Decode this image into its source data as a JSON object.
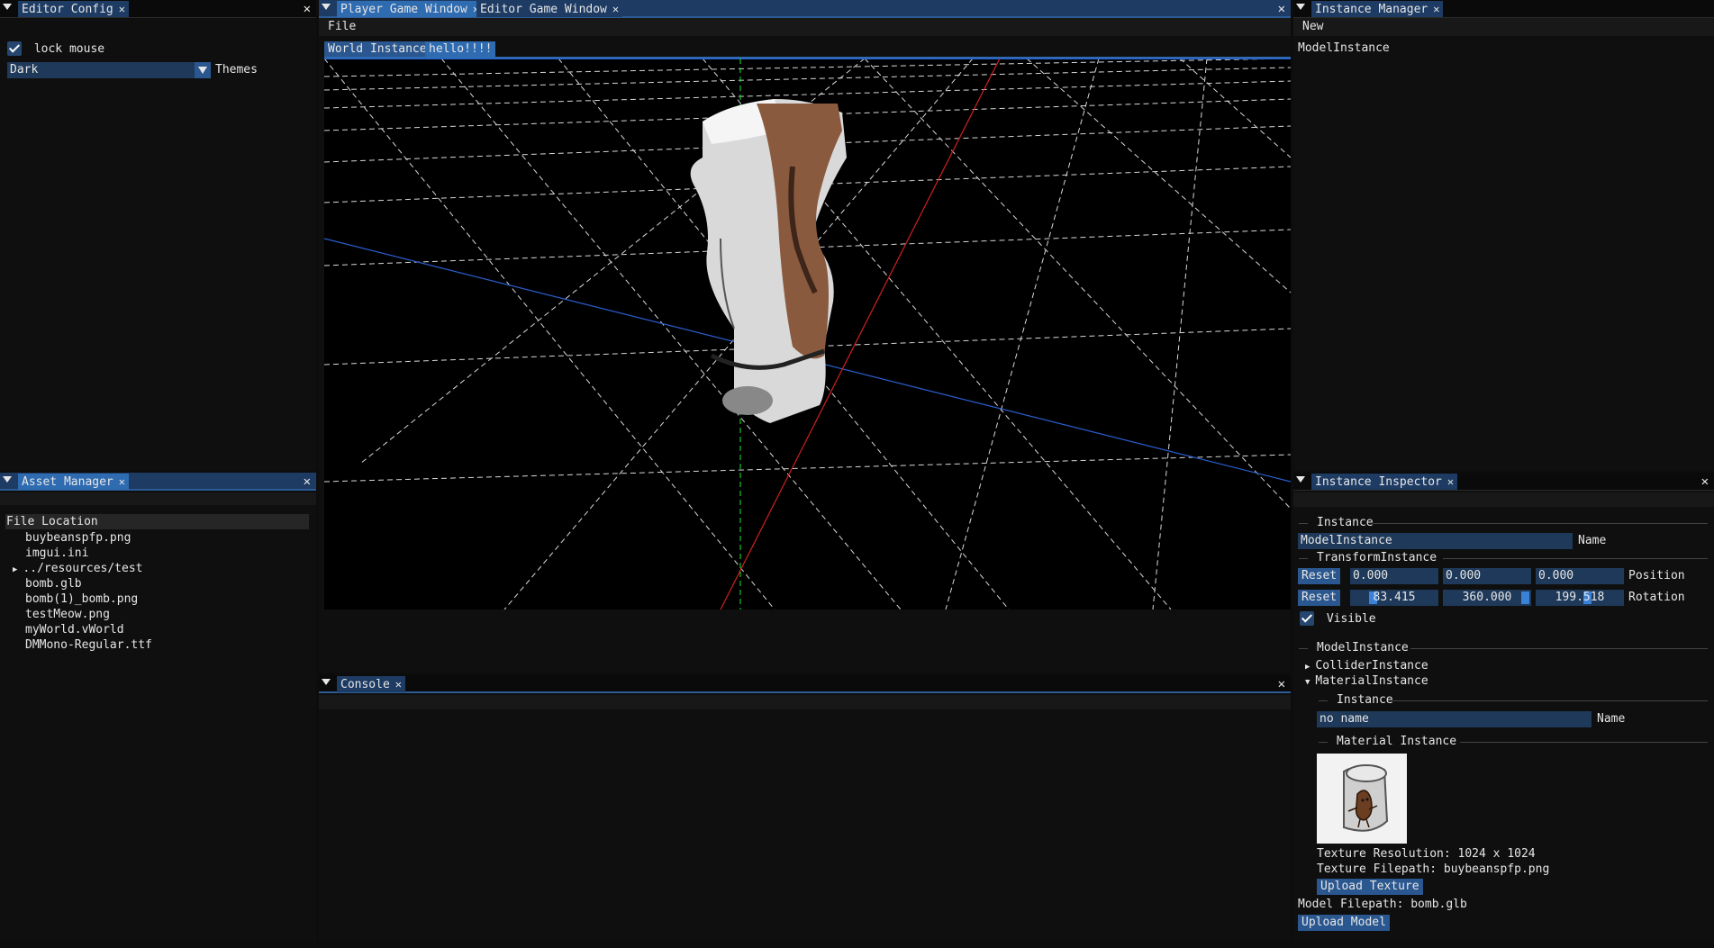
{
  "editor_config": {
    "tab": "Editor Config",
    "lock_mouse_label": "lock mouse",
    "theme_value": "Dark",
    "themes_label": "Themes"
  },
  "asset_manager": {
    "tab": "Asset Manager",
    "header": "File Location",
    "files": [
      "buybeanspfp.png",
      "imgui.ini",
      "../resources/test",
      "bomb.glb",
      "bomb(1)_bomb.png",
      "testMeow.png",
      "myWorld.vWorld",
      "DMMono-Regular.ttf"
    ]
  },
  "game_window": {
    "tab_player": "Player Game Window",
    "tab_editor": "Editor Game Window",
    "menu_file": "File",
    "inner_tab_world": "World Instance",
    "inner_tab_hello": "hello!!!!"
  },
  "console": {
    "tab": "Console"
  },
  "instance_manager": {
    "tab": "Instance Manager",
    "menu_new": "New",
    "item": "ModelInstance"
  },
  "inspector": {
    "tab": "Instance Inspector",
    "section_instance": "Instance",
    "name_value": "ModelInstance",
    "name_label": "Name",
    "section_transform": "TransformInstance",
    "reset_label": "Reset",
    "position": [
      "0.000",
      "0.000",
      "0.000"
    ],
    "position_label": "Position",
    "rotation": [
      "83.415",
      "360.000",
      "199.518"
    ],
    "rotation_label": "Rotation",
    "visible_label": "Visible",
    "section_model": "ModelInstance",
    "collider": "ColliderInstance",
    "material": "MaterialInstance",
    "mat_section_instance": "Instance",
    "mat_name_value": "no name",
    "mat_name_label": "Name",
    "mat_section_material": "Material Instance",
    "texture_resolution": "Texture Resolution: 1024 x 1024",
    "texture_filepath": "Texture Filepath: buybeanspfp.png",
    "upload_texture": "Upload Texture",
    "model_filepath": "Model Filepath: bomb.glb",
    "upload_model": "Upload Model"
  },
  "colors": {
    "active_tab": "#2e6bb0",
    "inactive_tab": "#1d3b63",
    "button": "#2a578f",
    "input": "#1e3959",
    "panel_bg": "#0f0f0f"
  }
}
